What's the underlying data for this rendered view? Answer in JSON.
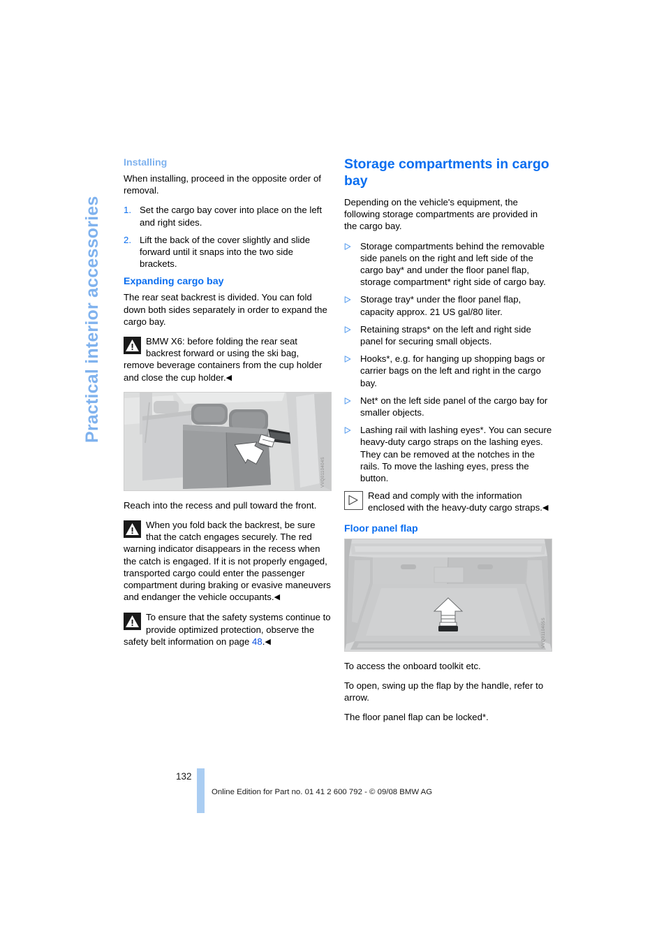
{
  "chapter_tab": "Practical interior accessories",
  "left_column": {
    "installing_heading": "Installing",
    "installing_intro": "When installing, proceed in the opposite order of removal.",
    "steps": [
      {
        "marker": "1.",
        "text": "Set the cargo bay cover into place on the left and right sides."
      },
      {
        "marker": "2.",
        "text": "Lift the back of the cover slightly and slide forward until it snaps into the two side brackets."
      }
    ],
    "expanding_heading": "Expanding cargo bay",
    "expanding_intro": "The rear seat backrest is divided. You can fold down both sides separately in order to expand the cargo bay.",
    "warning_1": "BMW X6: before folding the rear seat backrest forward or using the ski bag, remove beverage containers from the cup holder and close the cup holder.",
    "figure_1_code": "VVQ0110404S",
    "figure_1_caption": "Reach into the recess and pull toward the front.",
    "warning_2": "When you fold back the backrest, be sure that the catch engages securely. The red warning indicator disappears in the recess when the catch is engaged. If it is not properly engaged, transported cargo could enter the passenger compartment during braking or evasive maneuvers and endanger the vehicle occupants.",
    "warning_3_before": "To ensure that the safety systems continue to provide optimized protection, observe the safety belt information on page ",
    "warning_3_ref": "48",
    "warning_3_after": "."
  },
  "right_column": {
    "storage_heading": "Storage compartments in cargo bay",
    "storage_intro": "Depending on the vehicle's equipment, the following storage compartments are provided in the cargo bay.",
    "storage_bullets": [
      "Storage compartments behind the removable side panels on the right and left side of the cargo bay* and under the floor panel flap, storage compartment* right side of cargo bay.",
      "Storage tray* under the floor panel flap, capacity approx. 21 US gal/80 liter.",
      "Retaining straps* on the left and right side panel for securing small objects.",
      "Hooks*, e.g. for hanging up shopping bags or carrier bags on the left and right in the cargo bay.",
      "Net* on the left side panel of the cargo bay for smaller objects.",
      "Lashing rail with lashing eyes*. You can secure heavy-duty cargo straps on the lashing eyes.\nThey can be removed at the notches in the rails. To move the lashing eyes, press the button."
    ],
    "note_1": "Read and comply with the information enclosed with the heavy-duty cargo straps.",
    "floor_flap_heading": "Floor panel flap",
    "figure_2_code": "VVQ0110405S",
    "floor_flap_texts": [
      "To access the onboard toolkit etc.",
      "To open, swing up the flap by the handle, refer to arrow.",
      "The floor panel flap can be locked*."
    ]
  },
  "footer": {
    "page_number": "132",
    "edition_line": "Online Edition for Part no. 01 41 2 600 792 - © 09/08 BMW AG"
  },
  "colors": {
    "heading_blue": "#0a6ef0",
    "light_blue": "#7fb2ee",
    "link_blue": "#0a4fe0",
    "footer_bar": "#aacdf2"
  }
}
